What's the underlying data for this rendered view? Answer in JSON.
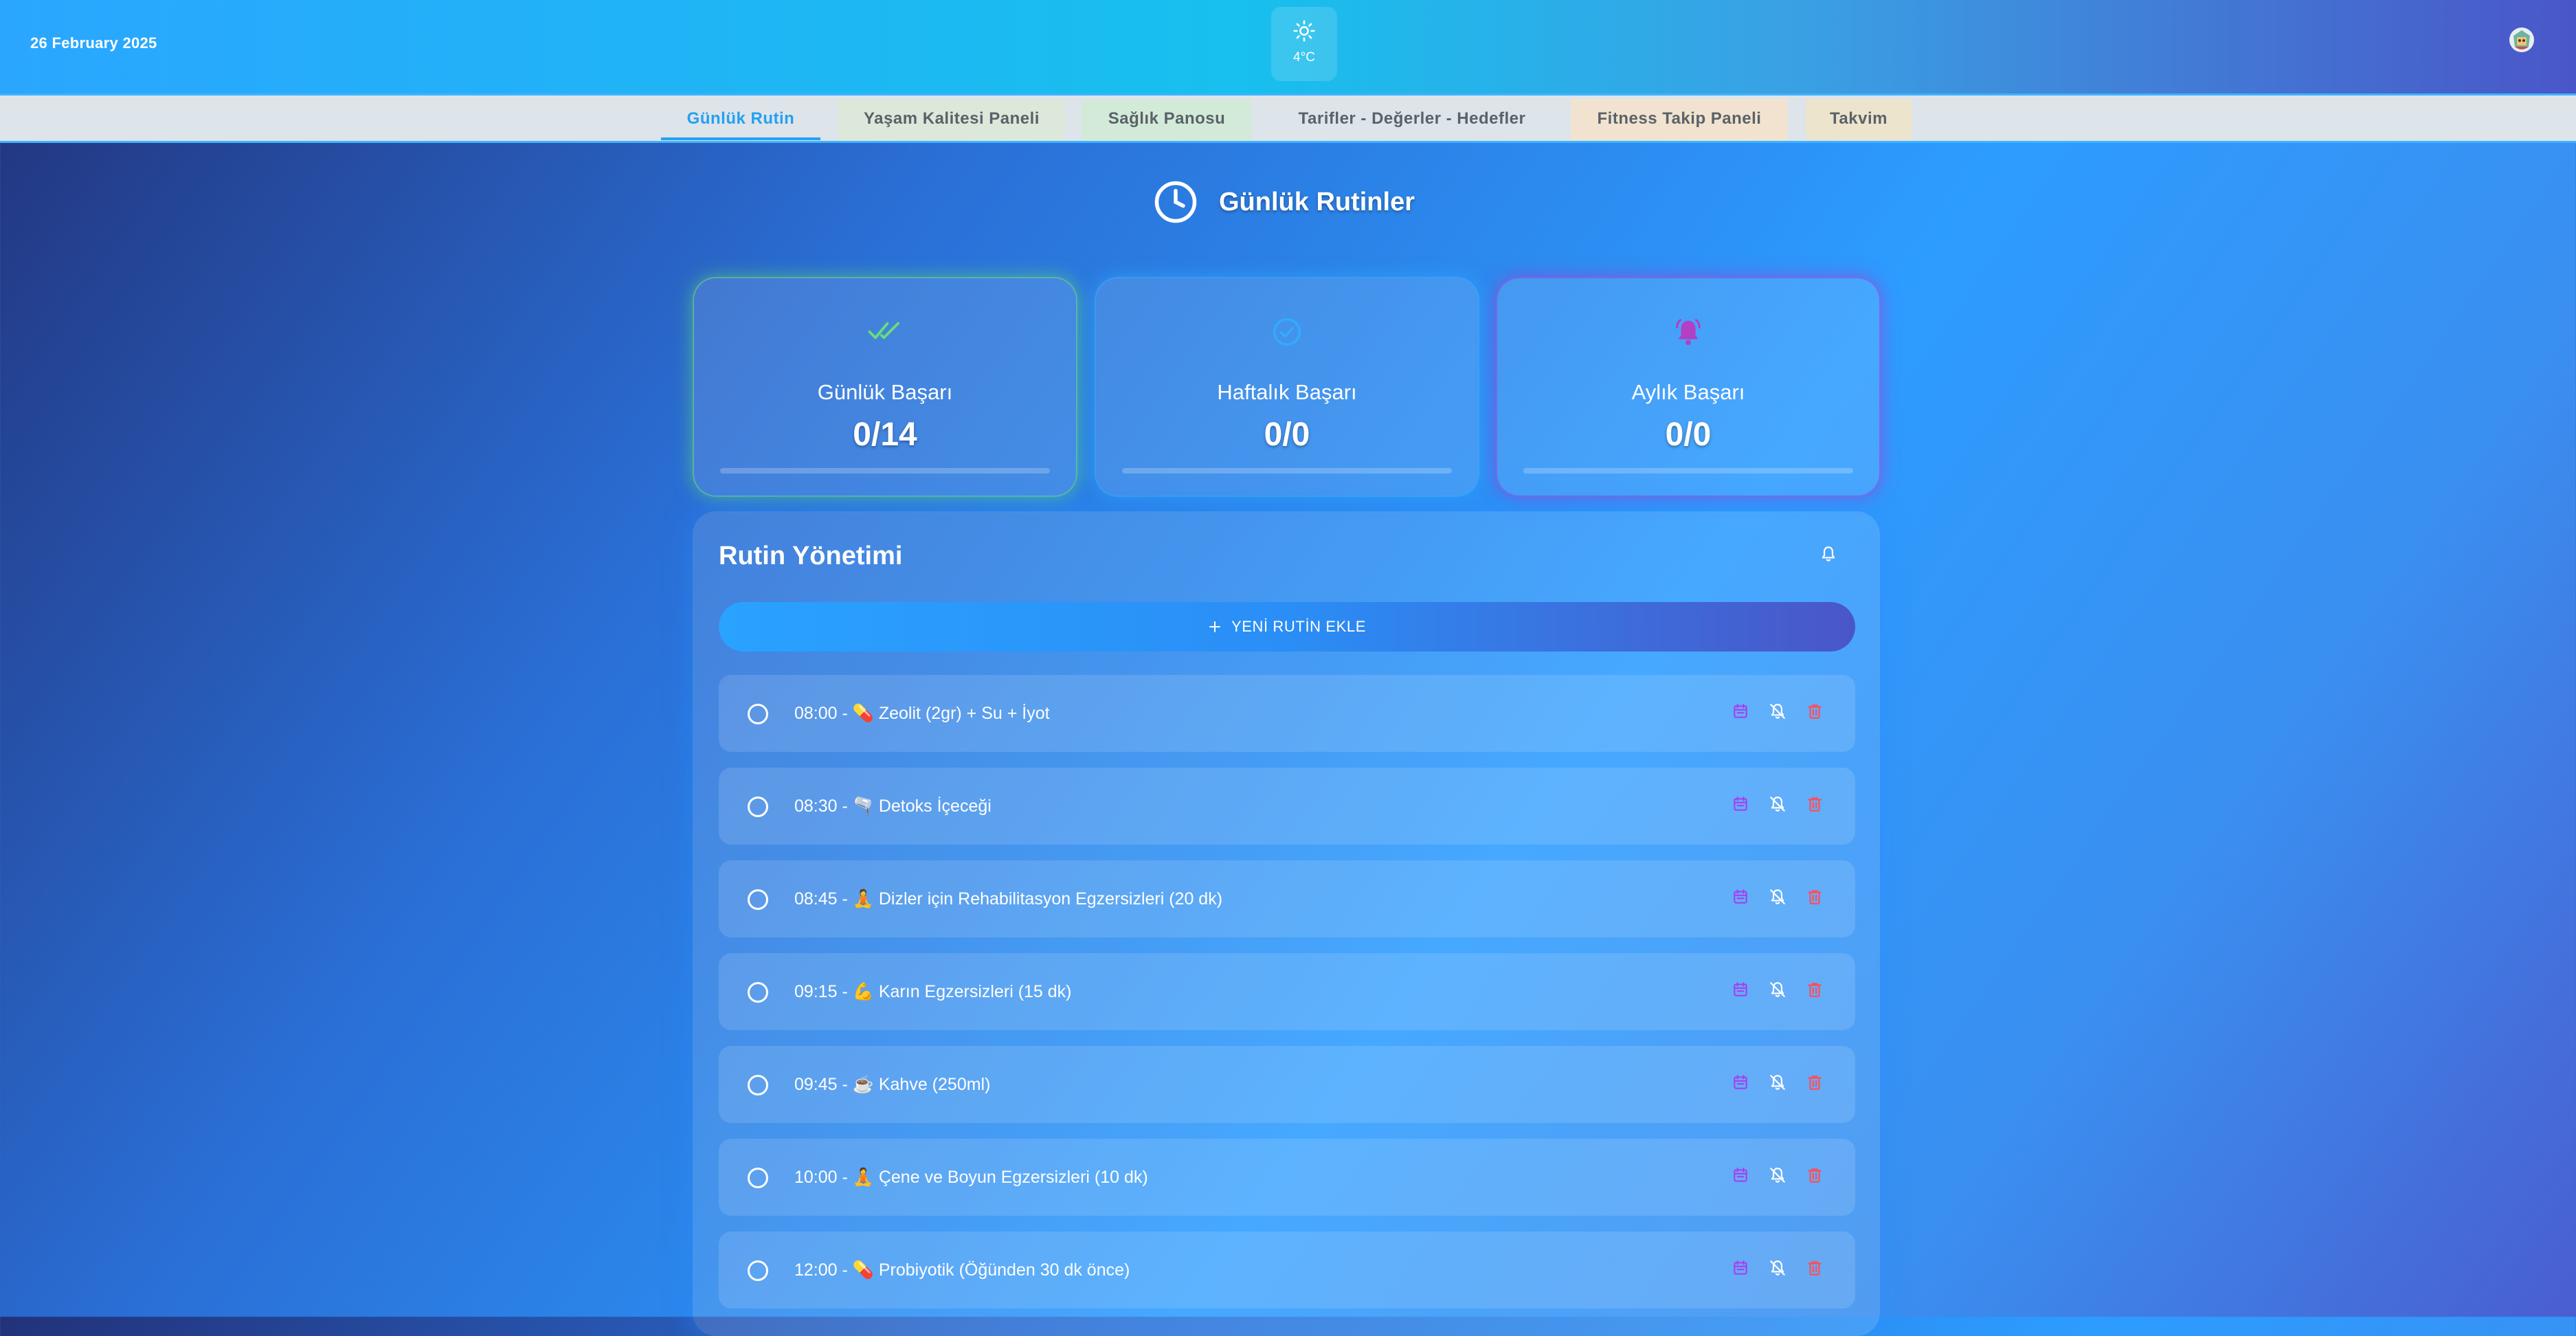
{
  "header": {
    "date": "26 February 2025",
    "weather": {
      "temp": "4°C",
      "icon": "sun-icon"
    },
    "avatar_icon": "avatar-icon"
  },
  "tabs": [
    {
      "label": "Günlük Rutin",
      "active": true,
      "bg": ""
    },
    {
      "label": "Yaşam Kalitesi Paneli",
      "active": false,
      "bg": "#dbe8da"
    },
    {
      "label": "Sağlık Panosu",
      "active": false,
      "bg": "#d3ead8"
    },
    {
      "label": "Tarifler - Değerler - Hedefler",
      "active": false,
      "bg": ""
    },
    {
      "label": "Fitness Takip Paneli",
      "active": false,
      "bg": "#f1e3cf"
    },
    {
      "label": "Takvim",
      "active": false,
      "bg": "#ece4cc"
    }
  ],
  "page": {
    "title": "Günlük Rutinler",
    "icon": "clock-icon"
  },
  "stats": [
    {
      "label": "Günlük Başarı",
      "value": "0/14",
      "progress": 0,
      "icon": "double-check-icon",
      "color": "#66dd77"
    },
    {
      "label": "Haftalık Başarı",
      "value": "0/0",
      "progress": 0,
      "icon": "check-circle-icon",
      "color": "#33aaff"
    },
    {
      "label": "Aylık Başarı",
      "value": "0/0",
      "progress": 0,
      "icon": "bell-ring-icon",
      "color": "#b23fc4"
    }
  ],
  "routine": {
    "title": "Rutin Yönetimi",
    "bell_icon": "bell-icon",
    "add_label": "YENİ RUTİN EKLE",
    "items": [
      {
        "text": "08:00 - 💊 Zeolit (2gr) + Su + İyot"
      },
      {
        "text": "08:30 - 🫗 Detoks İçeceği"
      },
      {
        "text": "08:45 - 🧘 Dizler için Rehabilitasyon Egzersizleri (20 dk)"
      },
      {
        "text": "09:15 - 💪 Karın Egzersizleri (15 dk)"
      },
      {
        "text": "09:45 - ☕ Kahve (250ml)"
      },
      {
        "text": "10:00 - 🧘 Çene ve Boyun Egzersizleri (10 dk)"
      },
      {
        "text": "12:00 - 💊 Probiyotik (Öğünden 30 dk önce)"
      }
    ],
    "action_icons": [
      "calendar-icon",
      "bell-off-icon",
      "trash-icon"
    ],
    "action_colors": [
      "#a63ff0",
      "#ffffff",
      "#ff4d5a"
    ]
  }
}
